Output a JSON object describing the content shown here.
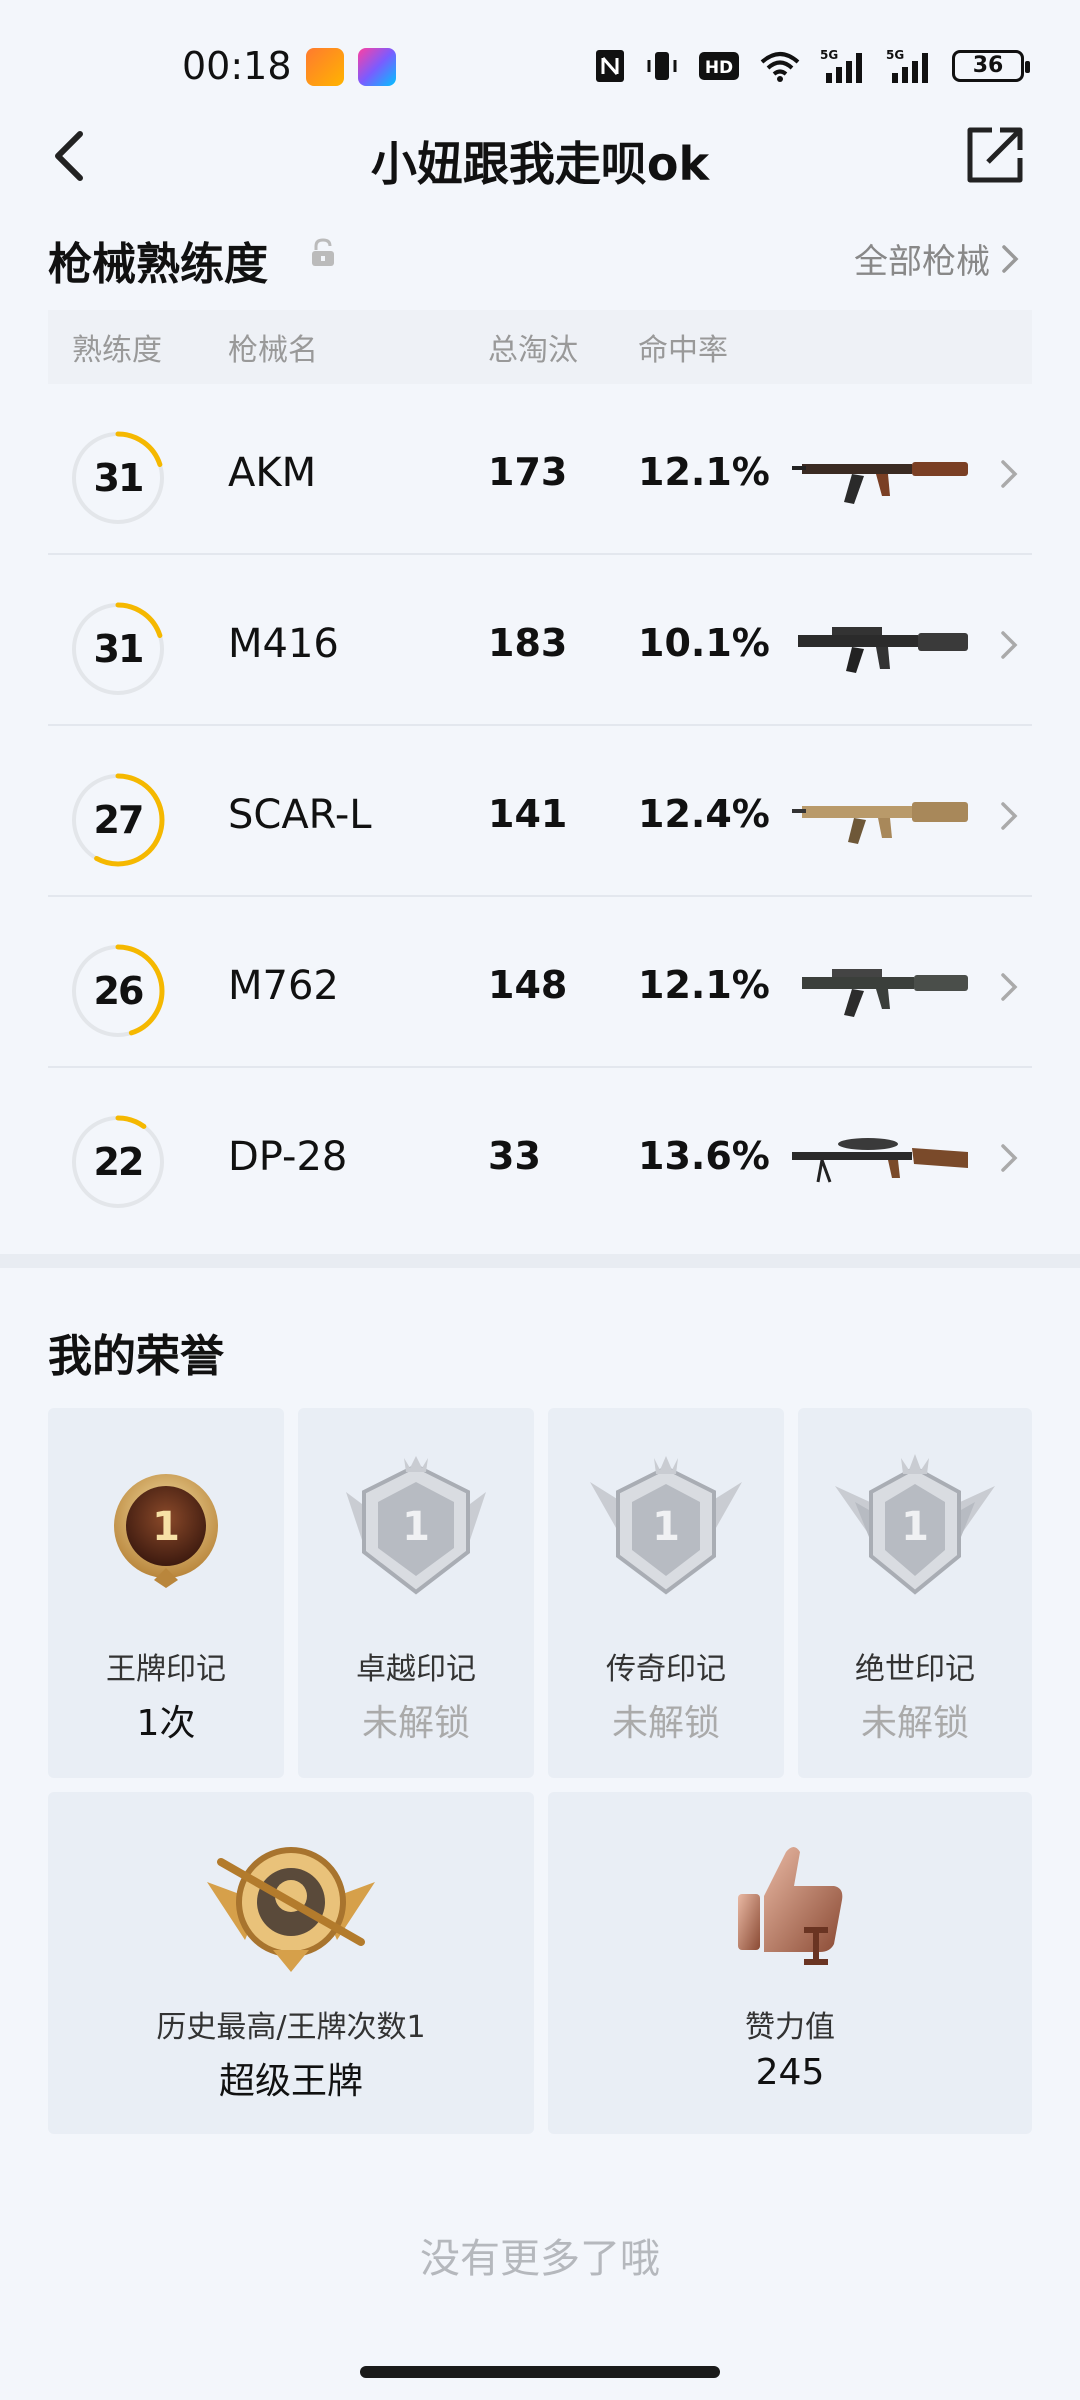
{
  "status_bar": {
    "time": "00:18",
    "battery": "36",
    "icons": [
      "nfc-icon",
      "vibrate-icon",
      "hd-icon",
      "wifi-icon",
      "5g-signal-icon",
      "5g-signal-icon",
      "battery-icon"
    ]
  },
  "header": {
    "title": "小妞跟我走呗ok"
  },
  "weapons_section": {
    "title": "枪械熟练度",
    "all_link": "全部枪械",
    "columns": [
      "熟练度",
      "枪械名",
      "总淘汰",
      "命中率"
    ],
    "rows": [
      {
        "level": "31",
        "name": "AKM",
        "kills": "173",
        "rate": "12.1%",
        "progress": 0.2,
        "image": "akm-rifle"
      },
      {
        "level": "31",
        "name": "M416",
        "kills": "183",
        "rate": "10.1%",
        "progress": 0.2,
        "image": "m416-rifle"
      },
      {
        "level": "27",
        "name": "SCAR-L",
        "kills": "141",
        "rate": "12.4%",
        "progress": 0.58,
        "image": "scar-l-rifle"
      },
      {
        "level": "26",
        "name": "M762",
        "kills": "148",
        "rate": "12.1%",
        "progress": 0.45,
        "image": "m762-rifle"
      },
      {
        "level": "22",
        "name": "DP-28",
        "kills": "33",
        "rate": "13.6%",
        "progress": 0.1,
        "image": "dp-28-lmg"
      }
    ]
  },
  "honor_section": {
    "title": "我的荣誉",
    "marks": [
      {
        "label": "王牌印记",
        "value": "1次",
        "locked": false,
        "emblem_num": "1"
      },
      {
        "label": "卓越印记",
        "value": "未解锁",
        "locked": true,
        "emblem_num": "1"
      },
      {
        "label": "传奇印记",
        "value": "未解锁",
        "locked": true,
        "emblem_num": "1"
      },
      {
        "label": "绝世印记",
        "value": "未解锁",
        "locked": true,
        "emblem_num": "1"
      }
    ],
    "highest": {
      "label": "历史最高/王牌次数1",
      "value": "超级王牌"
    },
    "likes": {
      "label": "赞力值",
      "value": "245"
    }
  },
  "footer": {
    "no_more": "没有更多了哦"
  },
  "colors": {
    "ring_progress": "#f5b800",
    "ring_track": "#e3e6ea",
    "background": "#f3f6fb"
  }
}
